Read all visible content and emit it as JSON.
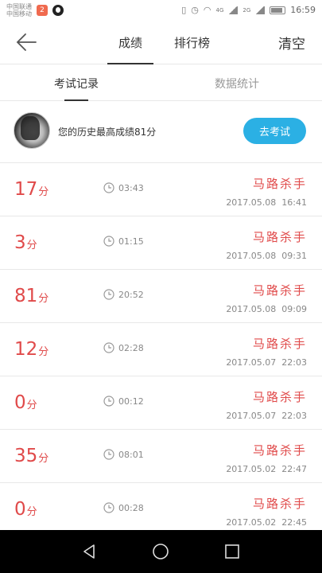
{
  "status_bar": {
    "carrier_line1": "中国联通",
    "carrier_line2": "中国移动",
    "app_badge": "2",
    "net_4g": "4G",
    "net_2g": "2G",
    "time": "16:59"
  },
  "nav": {
    "tabs": [
      {
        "label": "成绩",
        "active": true
      },
      {
        "label": "排行榜",
        "active": false
      }
    ],
    "clear_label": "清空"
  },
  "sub_tabs": [
    {
      "label": "考试记录",
      "active": true
    },
    {
      "label": "数据统计",
      "active": false
    }
  ],
  "profile": {
    "best_text": "您的历史最高成绩81分",
    "start_button": "去考试"
  },
  "records": [
    {
      "score": "17",
      "unit": "分",
      "duration": "03:43",
      "name": "马路杀手",
      "datetime": "2017.05.08  16:41"
    },
    {
      "score": "3",
      "unit": "分",
      "duration": "01:15",
      "name": "马路杀手",
      "datetime": "2017.05.08  09:31"
    },
    {
      "score": "81",
      "unit": "分",
      "duration": "20:52",
      "name": "马路杀手",
      "datetime": "2017.05.08  09:09"
    },
    {
      "score": "12",
      "unit": "分",
      "duration": "02:28",
      "name": "马路杀手",
      "datetime": "2017.05.07  22:03"
    },
    {
      "score": "0",
      "unit": "分",
      "duration": "00:12",
      "name": "马路杀手",
      "datetime": "2017.05.07  22:03"
    },
    {
      "score": "35",
      "unit": "分",
      "duration": "08:01",
      "name": "马路杀手",
      "datetime": "2017.05.02  22:47"
    },
    {
      "score": "0",
      "unit": "分",
      "duration": "00:28",
      "name": "马路杀手",
      "datetime": "2017.05.02  22:45"
    }
  ],
  "colors": {
    "accent_blue": "#2bb0e4",
    "score_red": "#e04a4a"
  }
}
